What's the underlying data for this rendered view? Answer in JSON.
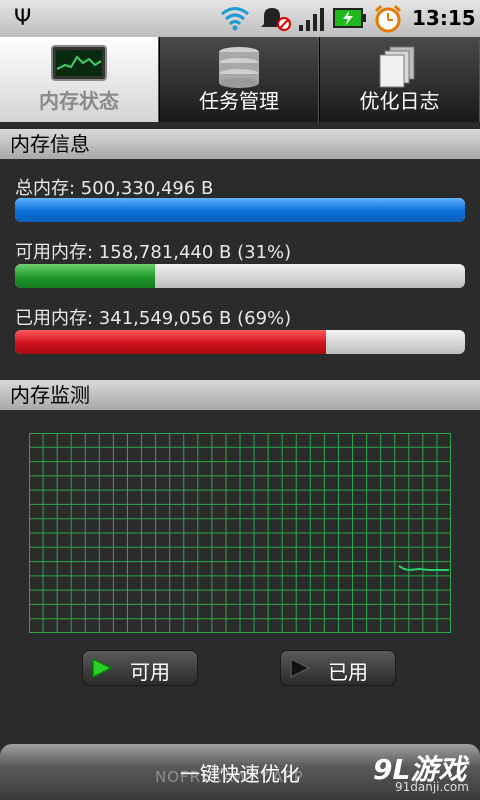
{
  "status_bar": {
    "time": "13:15",
    "usb_icon": "usb-icon",
    "icons": [
      "wifi-icon",
      "bell-muted-icon",
      "signal-icon",
      "battery-charging-icon",
      "alarm-icon"
    ]
  },
  "tabs": [
    {
      "label": "内存状态",
      "icon": "chart-monitor-icon",
      "active": true
    },
    {
      "label": "任务管理",
      "icon": "database-stack-icon",
      "active": false
    },
    {
      "label": "优化日志",
      "icon": "documents-icon",
      "active": false
    }
  ],
  "memory_info": {
    "title": "内存信息",
    "total": {
      "text": "总内存: 500,330,496 B",
      "fraction": 1.0,
      "color": "#0b6fd8"
    },
    "available": {
      "text": "可用内存: 158,781,440 B (31%)",
      "fraction": 0.31,
      "color": "#1f9a2a"
    },
    "used": {
      "text": "已用内存: 341,549,056 B (69%)",
      "fraction": 0.69,
      "color": "#d0121c"
    }
  },
  "monitor": {
    "title": "内存监测",
    "grid_color": "#2aa84a",
    "line_color": "#2ad06a",
    "legend_available": "可用",
    "legend_used": "已用"
  },
  "footer": {
    "button_label": "一键快速优化",
    "watermark": "NOFREXAWEY.APP",
    "badge_logo": "9L游戏",
    "badge_site": "91danji.com"
  }
}
